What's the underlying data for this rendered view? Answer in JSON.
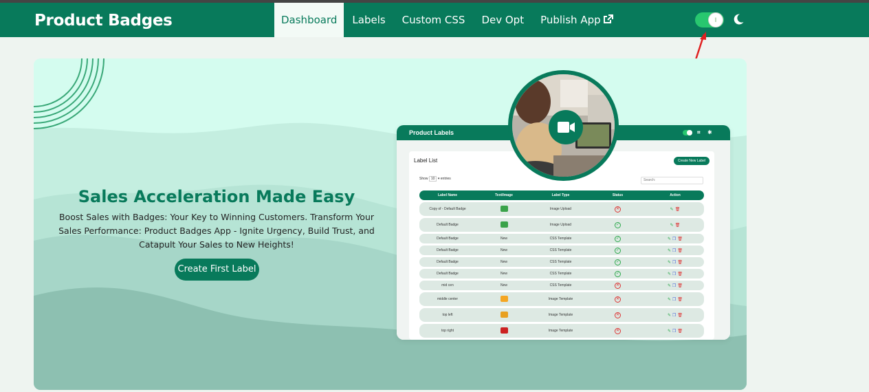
{
  "navbar": {
    "brand": "Product Badges",
    "items": [
      {
        "label": "Dashboard",
        "active": true
      },
      {
        "label": "Labels",
        "active": false
      },
      {
        "label": "Custom CSS",
        "active": false
      },
      {
        "label": "Dev Opt",
        "active": false
      },
      {
        "label": "Publish App",
        "active": false,
        "icon": "external-link-icon"
      }
    ],
    "toggle_glyph": "I",
    "theme_icon": "moon-icon"
  },
  "hero": {
    "headline": "Sales Acceleration Made Easy",
    "subtext": "Boost Sales with Badges: Your Key to Winning Customers. Transform Your Sales Performance: Product Badges App - Ignite Urgency, Build Trust, and Catapult Your Sales to New Heights!",
    "cta_label": "Create First Label",
    "video_icon": "video-camera-icon"
  },
  "preview": {
    "header_title": "Product Labels",
    "card_title": "Label List",
    "create_label": "Create New Label",
    "show_prefix": "Show",
    "show_value": "10",
    "show_suffix": "entries",
    "search_placeholder": "Search:",
    "columns": [
      "Label Name",
      "Text/Image",
      "Label Type",
      "Status",
      "Action"
    ],
    "rows": [
      {
        "name": "Copy of - Default Badge",
        "text": "",
        "img": "#3aa34a",
        "type": "Image Upload",
        "status": "inactive",
        "copy": false,
        "tall": true
      },
      {
        "name": "Default Badge",
        "text": "",
        "img": "#3aa34a",
        "type": "Image Upload",
        "status": "active",
        "copy": false,
        "tall": true
      },
      {
        "name": "Default Badge",
        "text": "New",
        "img": "",
        "type": "CSS Template",
        "status": "active",
        "copy": true,
        "tall": false
      },
      {
        "name": "Default Badge",
        "text": "New",
        "img": "",
        "type": "CSS Template",
        "status": "active",
        "copy": true,
        "tall": false
      },
      {
        "name": "Default Badge",
        "text": "New",
        "img": "",
        "type": "CSS Template",
        "status": "active",
        "copy": true,
        "tall": false
      },
      {
        "name": "Default Badge",
        "text": "New",
        "img": "",
        "type": "CSS Template",
        "status": "active",
        "copy": true,
        "tall": false
      },
      {
        "name": "mid cen",
        "text": "New",
        "img": "",
        "type": "CSS Template",
        "status": "inactive",
        "copy": true,
        "tall": false
      },
      {
        "name": "middle center",
        "text": "",
        "img": "#f5a623",
        "type": "Image Template",
        "status": "inactive",
        "copy": true,
        "tall": true
      },
      {
        "name": "top left",
        "text": "",
        "img": "#e8a020",
        "type": "Image Template",
        "status": "inactive",
        "copy": true,
        "tall": true
      },
      {
        "name": "top right",
        "text": "",
        "img": "#cc2222",
        "type": "Image Template",
        "status": "inactive",
        "copy": true,
        "tall": true
      }
    ]
  },
  "colors": {
    "brand": "#087a5b",
    "toggle_on": "#28c76f",
    "arrow": "#e02020"
  }
}
